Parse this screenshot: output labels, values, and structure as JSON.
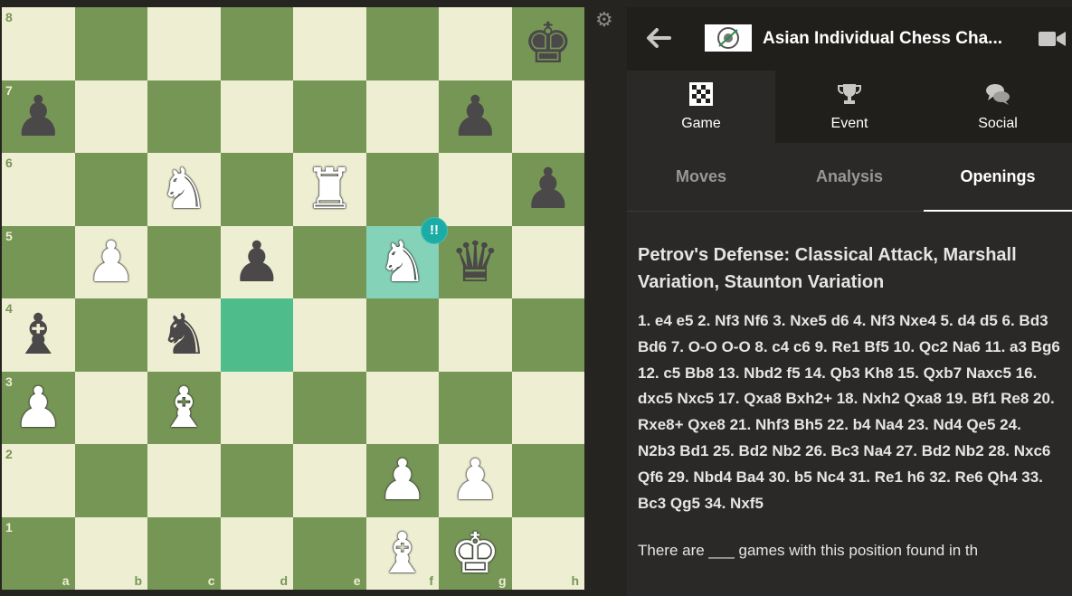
{
  "board": {
    "files": [
      "a",
      "b",
      "c",
      "d",
      "e",
      "f",
      "g",
      "h"
    ],
    "ranks": [
      "8",
      "7",
      "6",
      "5",
      "4",
      "3",
      "2",
      "1"
    ],
    "pieces": [
      {
        "square": "h8",
        "color": "black",
        "type": "king"
      },
      {
        "square": "a7",
        "color": "black",
        "type": "pawn"
      },
      {
        "square": "g7",
        "color": "black",
        "type": "pawn"
      },
      {
        "square": "c6",
        "color": "white",
        "type": "knight"
      },
      {
        "square": "e6",
        "color": "white",
        "type": "rook"
      },
      {
        "square": "h6",
        "color": "black",
        "type": "pawn"
      },
      {
        "square": "b5",
        "color": "white",
        "type": "pawn"
      },
      {
        "square": "d5",
        "color": "black",
        "type": "pawn"
      },
      {
        "square": "f5",
        "color": "white",
        "type": "knight"
      },
      {
        "square": "g5",
        "color": "black",
        "type": "queen"
      },
      {
        "square": "a4",
        "color": "black",
        "type": "bishop"
      },
      {
        "square": "c4",
        "color": "black",
        "type": "knight"
      },
      {
        "square": "a3",
        "color": "white",
        "type": "pawn"
      },
      {
        "square": "c3",
        "color": "white",
        "type": "bishop"
      },
      {
        "square": "f2",
        "color": "white",
        "type": "pawn"
      },
      {
        "square": "g2",
        "color": "white",
        "type": "pawn"
      },
      {
        "square": "f1",
        "color": "white",
        "type": "bishop"
      },
      {
        "square": "g1",
        "color": "white",
        "type": "king"
      }
    ],
    "last_move": {
      "from": "d4",
      "to": "f5"
    },
    "move_annotation": {
      "square": "f5",
      "label": "!!",
      "color": "#1baca6"
    },
    "colors": {
      "light": "#eeeed2",
      "dark": "#769656",
      "highlight_from": "#4fbc8b",
      "highlight_to": "#84d3b9"
    }
  },
  "header": {
    "back_icon": "arrow-left-icon",
    "event_title": "Asian Individual Chess Cha...",
    "video_icon": "video-camera-icon"
  },
  "main_tabs": [
    {
      "label": "Game",
      "icon": "checkerboard-icon",
      "active": true
    },
    {
      "label": "Event",
      "icon": "trophy-icon",
      "active": false
    },
    {
      "label": "Social",
      "icon": "chat-bubbles-icon",
      "active": false
    }
  ],
  "sub_tabs": [
    {
      "label": "Moves",
      "active": false
    },
    {
      "label": "Analysis",
      "active": false
    },
    {
      "label": "Openings",
      "active": true
    }
  ],
  "opening": {
    "name": "Petrov's Defense: Classical Attack, Marshall Variation, Staunton Variation",
    "moves": "1. e4 e5 2. Nf3 Nf6 3. Nxe5 d6 4. Nf3 Nxe4 5. d4 d5 6. Bd3 Bd6 7. O-O O-O 8. c4 c6 9. Re1 Bf5 10. Qc2 Na6 11. a3 Bg6 12. c5 Bb8 13. Nbd2 f5 14. Qb3 Kh8 15. Qxb7 Naxc5 16. dxc5 Nxc5 17. Qxa8 Bxh2+ 18. Nxh2 Qxa8 19. Bf1 Re8 20. Rxe8+ Qxe8 21. Nhf3 Bh5 22. b4 Na4 23. Nd4 Qe5 24. N2b3 Bd1 25. Bd2 Nb2 26. Bc3 Na4 27. Bd2 Nb2 28. Nxc6 Qf6 29. Nbd4 Ba4 30. b5 Nc4 31. Re1 h6 32. Re6 Qh4 33. Bc3 Qg5 34. Nxf5",
    "description": "There are ___ games with this position found in th"
  }
}
